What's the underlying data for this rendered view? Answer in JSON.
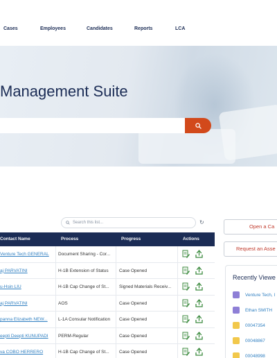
{
  "nav": {
    "items": [
      "Cases",
      "Employees",
      "Candidates",
      "Reports",
      "LCA"
    ]
  },
  "hero": {
    "title": "Management Suite",
    "search_placeholder": "",
    "accent_color": "#d2491b"
  },
  "list": {
    "search_placeholder": "Search this list...",
    "columns": [
      "Contact Name",
      "Process",
      "Progress",
      "Actions"
    ],
    "rows": [
      {
        "contact": "Venture Tech GENERAL",
        "process": "Document Sharing - Cor...",
        "progress": ""
      },
      {
        "contact": "aj PARVATINI",
        "process": "H-1B Extension of Status",
        "progress": "Case Opened"
      },
      {
        "contact": "u-Hsin LIU",
        "process": "H-1B Cap Change of St...",
        "progress": "Signed Materials Receiv..."
      },
      {
        "contact": "aj PARVATINI",
        "process": "AOS",
        "progress": "Case Opened"
      },
      {
        "contact": "panna Elizabeth NEW...",
        "process": "L-1A Consular Notification",
        "progress": "Case Opened"
      },
      {
        "contact": "eepti Deepti KUNUPADI",
        "process": "PERM-Regular",
        "progress": "Case Opened"
      },
      {
        "contact": "va COBO HERRERO",
        "process": "H-1B Cap Change of St...",
        "progress": "Case Opened"
      }
    ]
  },
  "side": {
    "open_case_label": "Open a Ca",
    "request_assessment_label": "Request an Asse",
    "recent_title": "Recently Viewe",
    "recent_items": [
      {
        "label": "Venture Tech, I",
        "icon": "contact-icon"
      },
      {
        "label": "Ethan SMITH",
        "icon": "contact-icon"
      },
      {
        "label": "00047354",
        "icon": "case-icon"
      },
      {
        "label": "00048867",
        "icon": "case-icon"
      },
      {
        "label": "00048998",
        "icon": "case-icon"
      }
    ]
  }
}
